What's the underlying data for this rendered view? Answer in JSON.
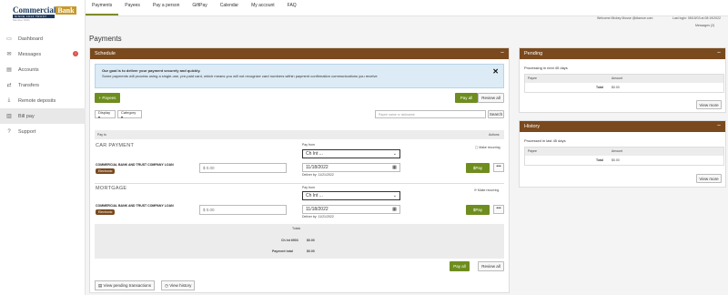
{
  "brand": {
    "name_part1": "Commercial",
    "name_part2": "Bank",
    "tagline": "SINCE 1914 TRUST COMPANY",
    "sub": "Member FDIC"
  },
  "sidebar": {
    "items": [
      {
        "label": "Dashboard",
        "icon": "dashboard-icon",
        "glyph": "▭"
      },
      {
        "label": "Messages",
        "icon": "envelope-icon",
        "glyph": "✉"
      },
      {
        "label": "Accounts",
        "icon": "accounts-icon",
        "glyph": "▤"
      },
      {
        "label": "Transfers",
        "icon": "transfer-icon",
        "glyph": "⇄"
      },
      {
        "label": "Remote deposits",
        "icon": "deposit-icon",
        "glyph": "⤓"
      },
      {
        "label": "Bill pay",
        "icon": "billpay-icon",
        "glyph": "▥"
      },
      {
        "label": "Support",
        "icon": "help-icon",
        "glyph": "?"
      }
    ],
    "messages_badge": "!"
  },
  "topnav": {
    "tabs": [
      "Payments",
      "Payees",
      "Pay a person",
      "GiftPay",
      "Calendar",
      "My account",
      "FAQ"
    ]
  },
  "header": {
    "welcome": "Welcome Mickey Mouse",
    "email": "@diamoe.com",
    "last_login": "Last login: 08/15/03 at 08:19/2022",
    "messages": "Messages (2)"
  },
  "page_title": "Payments",
  "schedule": {
    "title": "Schedule",
    "info_title": "Our goal is to deliver your payment securely and quickly.",
    "info_text": "Some payments will process using a single-use, pre-paid card, which means you will not recognize card numbers within payment confirmation communications you receive",
    "payees_button": "+ Payees",
    "pay_all": "Pay all",
    "review_all": "Review all",
    "display_dd": "Display ▾",
    "category_dd": "Category ▾",
    "search_placeholder": "Payee name or nickname",
    "search_button": "Search",
    "col_pay_to": "Pay to",
    "col_actions": "Actions",
    "payments": [
      {
        "name": "CAR PAYMENT ",
        "acct": "COMMERCIAL BANK AND TRUST COMPANY LOAN",
        "tag": "Electronic",
        "amount_placeholder": "$ 0.00",
        "pay_from_label": "Pay from",
        "pay_from": "Ch Int ...",
        "date": "11/18/2022",
        "deliver_by": "Deliver by: 11/21/2022",
        "make_recurring": "Make recurring",
        "pay_button": "$Pay",
        "more": "•••"
      },
      {
        "name": "MORTGAGE",
        "acct": "COMMERCIAL BANK AND TRUST COMPANY LOAN",
        "tag": "Electronic",
        "amount_placeholder": "$ 0.00",
        "pay_from_label": "Pay from",
        "pay_from": "Ch Int ...",
        "date": "11/18/2022",
        "deliver_by": "Deliver by: 11/21/2022",
        "make_recurring": "Make recurring",
        "pay_button": "$Pay",
        "more": "•••"
      }
    ],
    "totals_label": "Totals",
    "totals_rows": [
      {
        "label": "Ch Int 6903",
        "value": "$0.00"
      },
      {
        "label": "Payment total",
        "value": "$0.00"
      }
    ],
    "pay_all_bottom": "Pay all",
    "review_all_bottom": "Review all",
    "view_pending": "View pending transactions",
    "view_history": "View history"
  },
  "pending": {
    "title": "Pending",
    "caption": "Processing in next 45 days",
    "col_payee": "Payee",
    "col_amount": "Amount",
    "total_label": "Total",
    "total_value": "$0.00",
    "view_more": "View more"
  },
  "history": {
    "title": "History",
    "caption": "Processed in last 45 days",
    "col_payee": "Payee",
    "col_amount": "Amount",
    "total_label": "Total",
    "total_value": "$0.00",
    "view_more": "View more"
  },
  "colors": {
    "panel_head": "#7a4a1e",
    "accent_green": "#6e8d1f",
    "info_bg": "#dcebf5"
  }
}
